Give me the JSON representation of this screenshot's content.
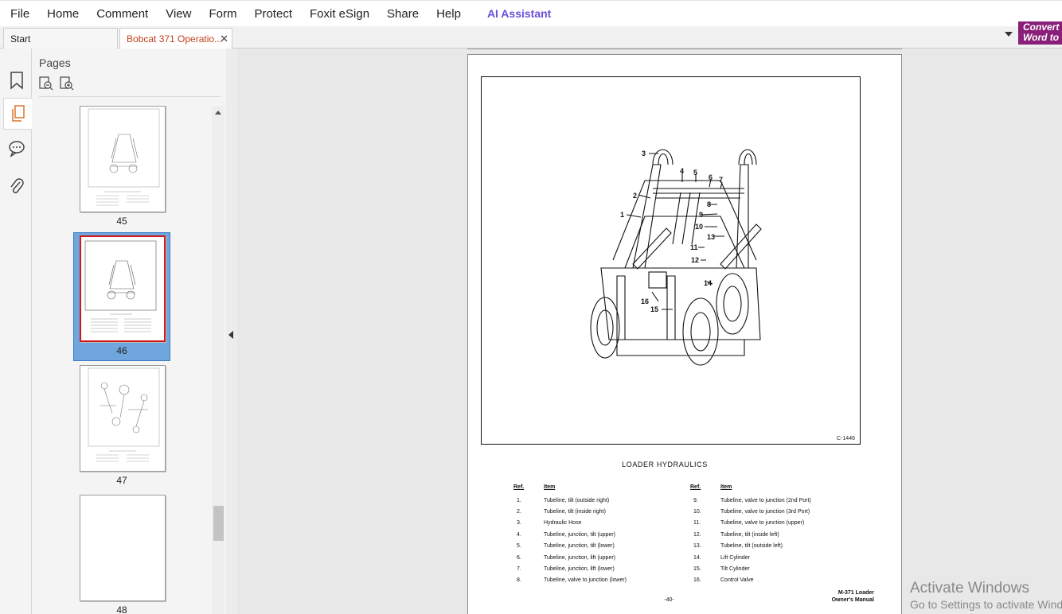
{
  "menu": [
    "File",
    "Home",
    "Comment",
    "View",
    "Form",
    "Protect",
    "Foxit eSign",
    "Share",
    "Help"
  ],
  "ai_assistant": "AI Assistant",
  "tabs": {
    "start": "Start",
    "document": "Bobcat 371 Operatio..."
  },
  "promo": {
    "line1": "Convert",
    "line2": "Word to"
  },
  "rail_icons": [
    "bookmark-icon",
    "pages-icon",
    "comment-icon",
    "attachment-icon"
  ],
  "panel": {
    "title": "Pages",
    "tools": [
      "zoom-out-thumbnail-icon",
      "zoom-in-thumbnail-icon"
    ]
  },
  "thumbnails": [
    {
      "label": "45",
      "selected": false
    },
    {
      "label": "46",
      "selected": true
    },
    {
      "label": "47",
      "selected": false
    },
    {
      "label": "48",
      "selected": false
    }
  ],
  "document": {
    "figure_code": "C-1446",
    "heading": "LOADER HYDRAULICS",
    "col_ref": "Ref.",
    "col_item": "Item",
    "callouts": [
      "1",
      "2",
      "3",
      "4",
      "5",
      "6",
      "7",
      "8",
      "9",
      "10",
      "11",
      "12",
      "13",
      "14",
      "15",
      "16"
    ],
    "parts_left": [
      {
        "ref": "1.",
        "item": "Tubeline, tilt (outside right)"
      },
      {
        "ref": "2.",
        "item": "Tubeline, tilt (inside right)"
      },
      {
        "ref": "3.",
        "item": "Hydraulic Hose"
      },
      {
        "ref": "4.",
        "item": "Tubeline, junction, tilt (upper)"
      },
      {
        "ref": "5.",
        "item": "Tubeline, junction, tilt (lower)"
      },
      {
        "ref": "6.",
        "item": "Tubeline, junction, lift (upper)"
      },
      {
        "ref": "7.",
        "item": "Tubeline, junction, lift (lower)"
      },
      {
        "ref": "8.",
        "item": "Tubeline, valve to junction (lower)"
      }
    ],
    "parts_right": [
      {
        "ref": "9.",
        "item": "Tubeline, valve to junction (2nd Port)"
      },
      {
        "ref": "10.",
        "item": "Tubeline, valve to junction (3rd Port)"
      },
      {
        "ref": "11.",
        "item": "Tubeline, valve to junction (upper)"
      },
      {
        "ref": "12.",
        "item": "Tubeline, tilt (inside left)"
      },
      {
        "ref": "13.",
        "item": "Tubeline, tilt (outside left)"
      },
      {
        "ref": "14.",
        "item": "Lift Cylinder"
      },
      {
        "ref": "15.",
        "item": "Tilt Cylinder"
      },
      {
        "ref": "16.",
        "item": "Control Valve"
      }
    ],
    "footer_model_1": "M-371 Loader",
    "footer_model_2": "Owner's Manual",
    "page_number": "-40-"
  },
  "watermark": {
    "line1": "Activate Windows",
    "line2": "Go to Settings to activate Windows."
  }
}
